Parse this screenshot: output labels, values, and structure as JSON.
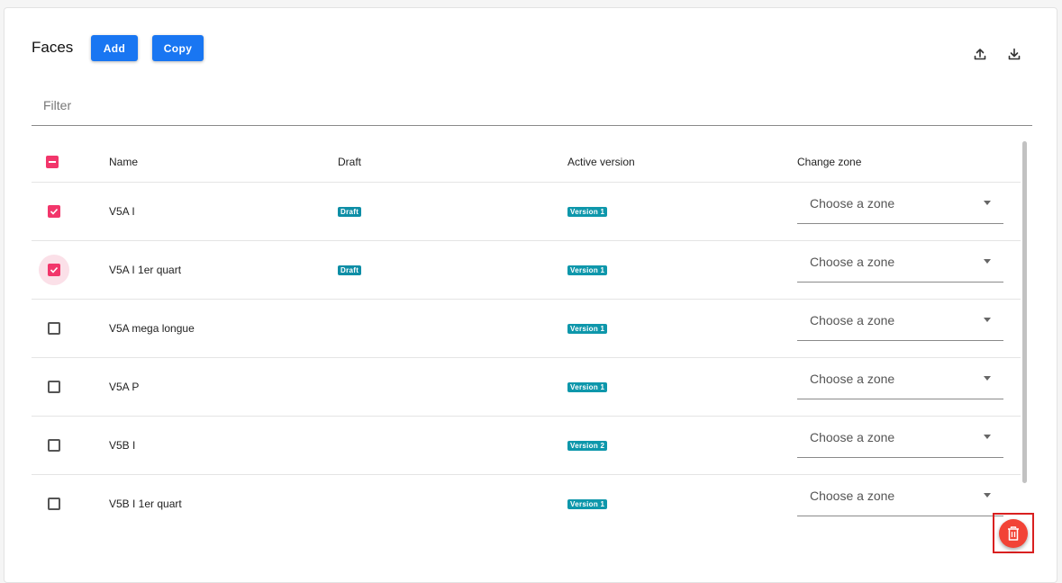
{
  "header": {
    "title": "Faces",
    "add_label": "Add",
    "copy_label": "Copy",
    "upload_icon": "upload-icon",
    "download_icon": "download-icon"
  },
  "filter": {
    "placeholder": "Filter",
    "value": ""
  },
  "table": {
    "columns": [
      "Name",
      "Draft",
      "Active version",
      "Change zone"
    ],
    "select_all_state": "indeterminate",
    "rows": [
      {
        "name": "V5A I",
        "draft": "Draft",
        "active_version": "Version 1",
        "zone_placeholder": "Choose a zone",
        "checked": true
      },
      {
        "name": "V5A I 1er quart",
        "draft": "Draft",
        "active_version": "Version 1",
        "zone_placeholder": "Choose a zone",
        "checked": true
      },
      {
        "name": "V5A mega longue",
        "draft": "",
        "active_version": "Version 1",
        "zone_placeholder": "Choose a zone",
        "checked": false
      },
      {
        "name": "V5A P",
        "draft": "",
        "active_version": "Version 1",
        "zone_placeholder": "Choose a zone",
        "checked": false
      },
      {
        "name": "V5B I",
        "draft": "",
        "active_version": "Version 2",
        "zone_placeholder": "Choose a zone",
        "checked": false
      },
      {
        "name": "V5B I 1er quart",
        "draft": "",
        "active_version": "Version 1",
        "zone_placeholder": "Choose a zone",
        "checked": false
      }
    ]
  },
  "colors": {
    "primary": "#1976f2",
    "checkbox_accent": "#f2366b",
    "badge": "#0e97ab",
    "delete_fab": "#f24336"
  },
  "fab": {
    "icon": "trash-icon"
  }
}
